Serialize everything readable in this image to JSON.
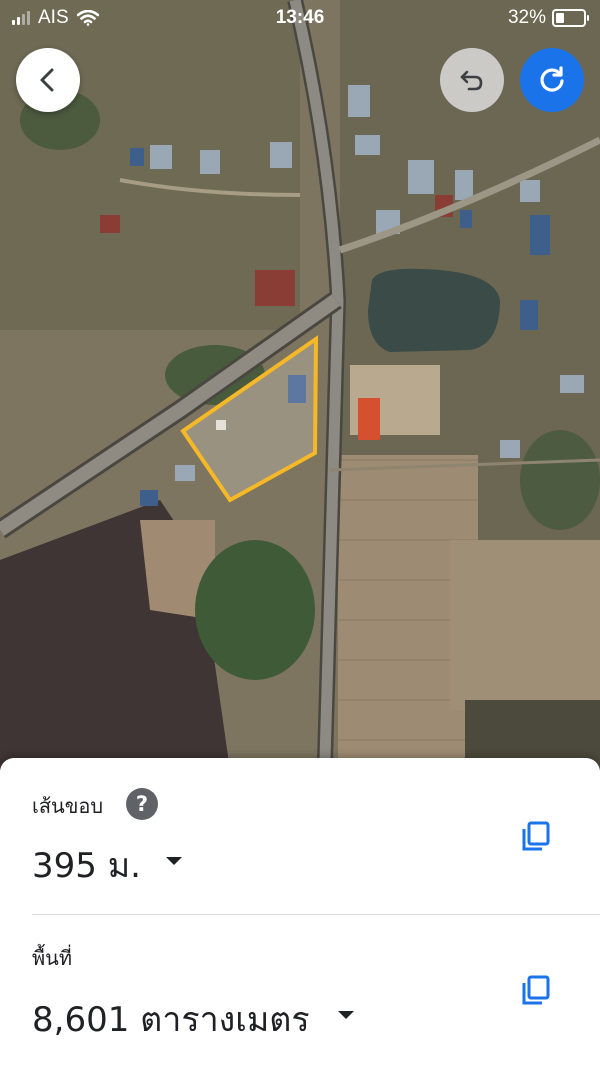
{
  "status_bar": {
    "carrier": "AIS",
    "time": "13:46",
    "battery": "32%",
    "battery_level": 0.32
  },
  "toolbar": {
    "back_icon": "chevron-left-icon",
    "undo_icon": "undo-icon",
    "redo_icon": "redo-icon",
    "accent": "#1a73e8"
  },
  "measurement": {
    "perimeter_label": "เส้นขอบ",
    "perimeter_value": "395 ม.",
    "area_label": "พื้นที่",
    "area_value": "8,601 ตารางเมตร",
    "outline_color": "#f6b826"
  }
}
